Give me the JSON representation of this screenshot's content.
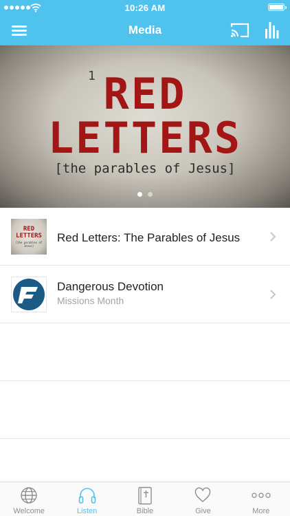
{
  "status_bar": {
    "time": "10:26 AM"
  },
  "nav": {
    "title": "Media",
    "menu_icon": "hamburger-menu-icon",
    "cast_icon": "cast-icon",
    "audio_icon": "audio-bars-icon"
  },
  "banner": {
    "number": "1",
    "title_line1": "RED",
    "title_line2": "LETTERS",
    "subtitle": "[the parables of Jesus]",
    "page_count": 2,
    "active_page": 1,
    "accent": "#a31616"
  },
  "media_items": [
    {
      "title": "Red Letters: The Parables of Jesus",
      "subtitle": "",
      "thumb": {
        "line1": "RED LETTERS",
        "line2": "[the parables of Jesus]"
      }
    },
    {
      "title": "Dangerous Devotion",
      "subtitle": "Missions Month",
      "thumb_icon": "church-logo-icon"
    }
  ],
  "tabs": [
    {
      "label": "Welcome",
      "icon": "globe-icon",
      "active": false
    },
    {
      "label": "Listen",
      "icon": "headphones-icon",
      "active": true
    },
    {
      "label": "Bible",
      "icon": "bible-icon",
      "active": false
    },
    {
      "label": "Give",
      "icon": "heart-icon",
      "active": false
    },
    {
      "label": "More",
      "icon": "more-dots-icon",
      "active": false
    }
  ],
  "colors": {
    "header": "#4fc3ee",
    "active_tab": "#4fc3ee",
    "logo_blue": "#1c5a86"
  }
}
